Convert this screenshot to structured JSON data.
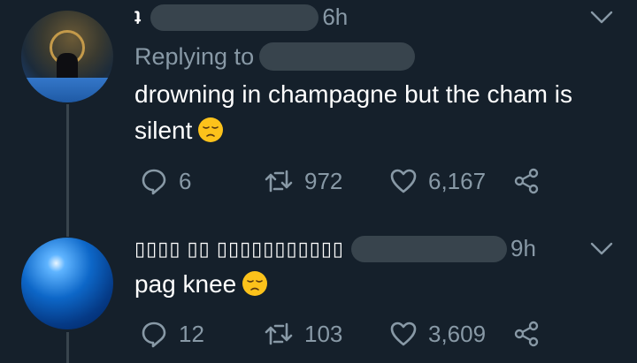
{
  "tweets": [
    {
      "author": "ʇ",
      "time": "6h",
      "replying_label": "Replying to",
      "text": "drowning in champagne but the cham is silent",
      "emoji": "pensive-face",
      "replies": "6",
      "retweets": "972",
      "likes": "6,167"
    },
    {
      "author": "▯▯▯▯ ▯▯ ▯▯▯▯▯▯▯▯▯▯▯",
      "time": "9h",
      "text": "pag knee",
      "emoji": "pensive-face",
      "replies": "12",
      "retweets": "103",
      "likes": "3,609"
    }
  ],
  "colors": {
    "background": "#15202b",
    "secondary_text": "#8899a6",
    "divider": "#38444d"
  },
  "icons": [
    "reply-icon",
    "retweet-icon",
    "like-icon",
    "share-icon",
    "chevron-down-icon"
  ]
}
